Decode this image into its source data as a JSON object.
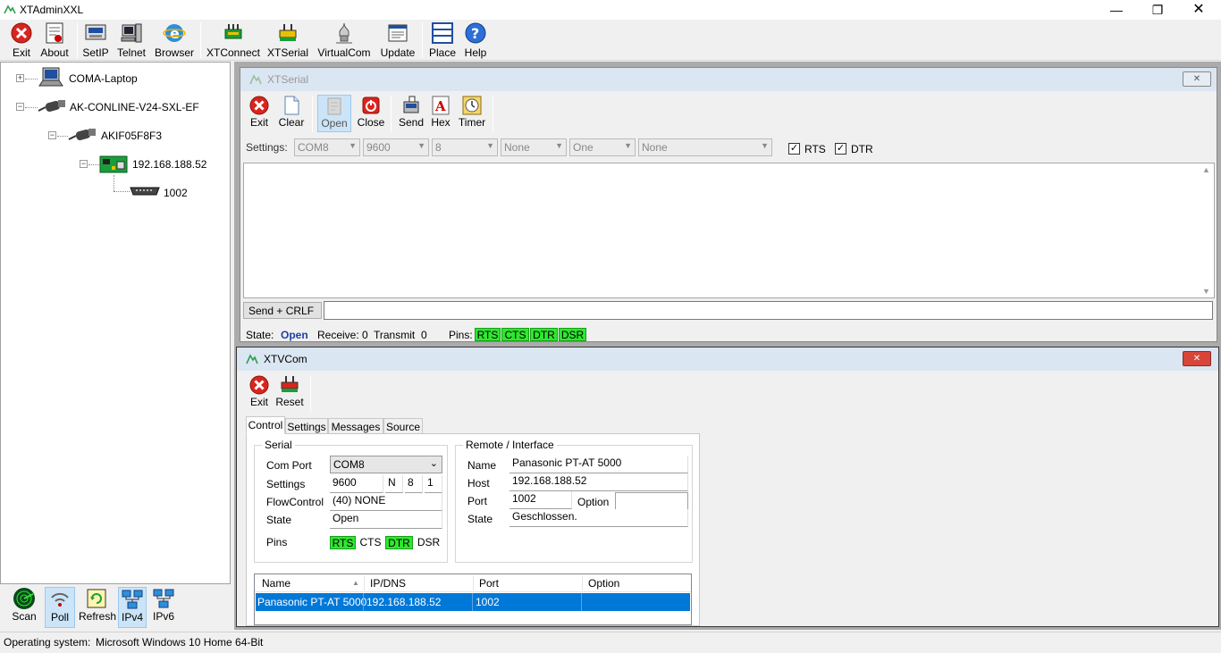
{
  "app": {
    "title": "XTAdminXXL"
  },
  "toolbar": {
    "exit": "Exit",
    "about": "About",
    "setip": "SetIP",
    "telnet": "Telnet",
    "browser": "Browser",
    "xtconnect": "XTConnect",
    "xtserial": "XTSerial",
    "virtualcom": "VirtualCom",
    "update": "Update",
    "place": "Place",
    "help": "Help"
  },
  "tree": {
    "nodes": [
      "COMA-Laptop",
      "AK-CONLINE-V24-SXL-EF",
      "AKIF05F8F3",
      "192.168.188.52",
      "1002"
    ]
  },
  "lefttools": {
    "scan": "Scan",
    "poll": "Poll",
    "refresh": "Refresh",
    "ipv4": "IPv4",
    "ipv6": "IPv6"
  },
  "status": {
    "label": "Operating system:",
    "value": "Microsoft Windows 10 Home 64-Bit"
  },
  "xtserial": {
    "title": "XTSerial",
    "buttons": {
      "exit": "Exit",
      "clear": "Clear",
      "open": "Open",
      "close": "Close",
      "send": "Send",
      "hex": "Hex",
      "timer": "Timer"
    },
    "settings_label": "Settings:",
    "port": "COM8",
    "baud": "9600",
    "databits": "8",
    "parity": "None",
    "stopbits": "One",
    "handshake": "None",
    "rts_label": "RTS",
    "dtr_label": "DTR",
    "send_button": "Send + CRLF",
    "state_label": "State:",
    "state_value": "Open",
    "receive_label": "Receive:",
    "receive_value": "0",
    "transmit_label": "Transmit",
    "transmit_value": "0",
    "pins_label": "Pins:",
    "pins": [
      "RTS",
      "CTS",
      "DTR",
      "DSR"
    ]
  },
  "xtvcom": {
    "title": "XTVCom",
    "buttons": {
      "exit": "Exit",
      "reset": "Reset"
    },
    "tabs": [
      "Control",
      "Settings",
      "Messages",
      "Source"
    ],
    "serial": {
      "title": "Serial",
      "comport_label": "Com Port",
      "comport_value": "COM8",
      "settings_label": "Settings",
      "baud": "9600",
      "parity": "N",
      "databits": "8",
      "stopbits": "1",
      "flow_label": "FlowControl",
      "flow_value": "(40) NONE",
      "state_label": "State",
      "state_value": "Open",
      "pins_label": "Pins",
      "pins": [
        "RTS",
        "CTS",
        "DTR",
        "DSR"
      ]
    },
    "remote": {
      "title": "Remote / Interface",
      "name_label": "Name",
      "name_value": "Panasonic PT-AT 5000",
      "host_label": "Host",
      "host_value": "192.168.188.52",
      "port_label": "Port",
      "port_value": "1002",
      "option_label": "Option",
      "option_value": "",
      "state_label": "State",
      "state_value": "Geschlossen."
    },
    "table": {
      "columns": [
        "Name",
        "IP/DNS",
        "Port",
        "Option"
      ],
      "rows": [
        [
          "Panasonic PT-AT 5000",
          "192.168.188.52",
          "1002",
          ""
        ]
      ]
    }
  }
}
